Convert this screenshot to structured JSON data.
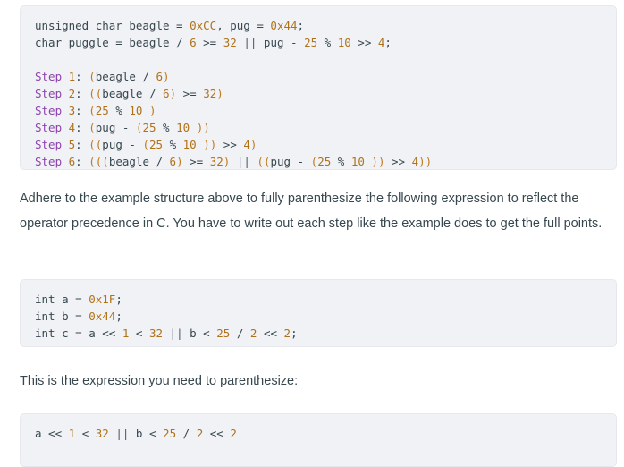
{
  "example_block": {
    "name": "example-code-block",
    "lines": [
      [
        {
          "t": "unsigned char beagle = ",
          "c": "plain"
        },
        {
          "t": "0xCC",
          "c": "hex"
        },
        {
          "t": ", pug = ",
          "c": "plain"
        },
        {
          "t": "0x44",
          "c": "hex"
        },
        {
          "t": ";",
          "c": "punct"
        }
      ],
      [
        {
          "t": "char puggle = beagle / ",
          "c": "plain"
        },
        {
          "t": "6",
          "c": "num"
        },
        {
          "t": " >= ",
          "c": "plain"
        },
        {
          "t": "32",
          "c": "num"
        },
        {
          "t": " ",
          "c": "plain"
        },
        {
          "t": "||",
          "c": "or"
        },
        {
          "t": " pug - ",
          "c": "plain"
        },
        {
          "t": "25",
          "c": "num"
        },
        {
          "t": " % ",
          "c": "plain"
        },
        {
          "t": "10",
          "c": "num"
        },
        {
          "t": " >> ",
          "c": "plain"
        },
        {
          "t": "4",
          "c": "num"
        },
        {
          "t": ";",
          "c": "punct"
        }
      ],
      [
        {
          "t": "",
          "c": "plain"
        }
      ],
      [
        {
          "t": "Step",
          "c": "step"
        },
        {
          "t": " ",
          "c": "plain"
        },
        {
          "t": "1",
          "c": "num"
        },
        {
          "t": ": ",
          "c": "plain"
        },
        {
          "t": "(",
          "c": "paren"
        },
        {
          "t": "beagle / ",
          "c": "plain"
        },
        {
          "t": "6",
          "c": "num"
        },
        {
          "t": ")",
          "c": "paren"
        }
      ],
      [
        {
          "t": "Step",
          "c": "step"
        },
        {
          "t": " ",
          "c": "plain"
        },
        {
          "t": "2",
          "c": "num"
        },
        {
          "t": ": ",
          "c": "plain"
        },
        {
          "t": "((",
          "c": "paren"
        },
        {
          "t": "beagle / ",
          "c": "plain"
        },
        {
          "t": "6",
          "c": "num"
        },
        {
          "t": ")",
          "c": "paren"
        },
        {
          "t": " >= ",
          "c": "plain"
        },
        {
          "t": "32",
          "c": "num"
        },
        {
          "t": ")",
          "c": "paren"
        }
      ],
      [
        {
          "t": "Step",
          "c": "step"
        },
        {
          "t": " ",
          "c": "plain"
        },
        {
          "t": "3",
          "c": "num"
        },
        {
          "t": ": ",
          "c": "plain"
        },
        {
          "t": "(",
          "c": "paren"
        },
        {
          "t": "25",
          "c": "num"
        },
        {
          "t": " % ",
          "c": "plain"
        },
        {
          "t": "10",
          "c": "num"
        },
        {
          "t": " ",
          "c": "plain"
        },
        {
          "t": ")",
          "c": "paren"
        }
      ],
      [
        {
          "t": "Step",
          "c": "step"
        },
        {
          "t": " ",
          "c": "plain"
        },
        {
          "t": "4",
          "c": "num"
        },
        {
          "t": ": ",
          "c": "plain"
        },
        {
          "t": "(",
          "c": "paren"
        },
        {
          "t": "pug - ",
          "c": "plain"
        },
        {
          "t": "(",
          "c": "paren"
        },
        {
          "t": "25",
          "c": "num"
        },
        {
          "t": " % ",
          "c": "plain"
        },
        {
          "t": "10",
          "c": "num"
        },
        {
          "t": " ",
          "c": "plain"
        },
        {
          "t": "))",
          "c": "paren"
        }
      ],
      [
        {
          "t": "Step",
          "c": "step"
        },
        {
          "t": " ",
          "c": "plain"
        },
        {
          "t": "5",
          "c": "num"
        },
        {
          "t": ": ",
          "c": "plain"
        },
        {
          "t": "((",
          "c": "paren"
        },
        {
          "t": "pug - ",
          "c": "plain"
        },
        {
          "t": "(",
          "c": "paren"
        },
        {
          "t": "25",
          "c": "num"
        },
        {
          "t": " % ",
          "c": "plain"
        },
        {
          "t": "10",
          "c": "num"
        },
        {
          "t": " ",
          "c": "plain"
        },
        {
          "t": "))",
          "c": "paren"
        },
        {
          "t": " >> ",
          "c": "plain"
        },
        {
          "t": "4",
          "c": "num"
        },
        {
          "t": ")",
          "c": "paren"
        }
      ],
      [
        {
          "t": "Step",
          "c": "step"
        },
        {
          "t": " ",
          "c": "plain"
        },
        {
          "t": "6",
          "c": "num"
        },
        {
          "t": ": ",
          "c": "plain"
        },
        {
          "t": "(((",
          "c": "paren"
        },
        {
          "t": "beagle / ",
          "c": "plain"
        },
        {
          "t": "6",
          "c": "num"
        },
        {
          "t": ")",
          "c": "paren"
        },
        {
          "t": " >= ",
          "c": "plain"
        },
        {
          "t": "32",
          "c": "num"
        },
        {
          "t": ")",
          "c": "paren"
        },
        {
          "t": " ",
          "c": "plain"
        },
        {
          "t": "||",
          "c": "or"
        },
        {
          "t": " ",
          "c": "plain"
        },
        {
          "t": "((",
          "c": "paren"
        },
        {
          "t": "pug - ",
          "c": "plain"
        },
        {
          "t": "(",
          "c": "paren"
        },
        {
          "t": "25",
          "c": "num"
        },
        {
          "t": " % ",
          "c": "plain"
        },
        {
          "t": "10",
          "c": "num"
        },
        {
          "t": " ",
          "c": "plain"
        },
        {
          "t": "))",
          "c": "paren"
        },
        {
          "t": " >> ",
          "c": "plain"
        },
        {
          "t": "4",
          "c": "num"
        },
        {
          "t": "))",
          "c": "paren"
        }
      ]
    ],
    "plain_text": "unsigned char beagle = 0xCC, pug = 0x44;\nchar puggle = beagle / 6 >= 32 || pug - 25 % 10 >> 4;\n\nStep 1: (beagle / 6)\nStep 2: ((beagle / 6) >= 32)\nStep 3: (25 % 10 )\nStep 4: (pug - (25 % 10 ))\nStep 5: ((pug - (25 % 10 )) >> 4)\nStep 6: (((beagle / 6) >= 32) || ((pug - (25 % 10 )) >> 4))"
  },
  "instructions": {
    "name": "instructions-paragraph",
    "text": "Adhere to the example structure above to fully parenthesize the following expression to reflect the operator precedence in C. You have to write out each step like the example does to get the full points."
  },
  "problem_block": {
    "name": "problem-code-block",
    "lines": [
      [
        {
          "t": "int a = ",
          "c": "plain"
        },
        {
          "t": "0x1F",
          "c": "hex"
        },
        {
          "t": ";",
          "c": "punct"
        }
      ],
      [
        {
          "t": "int b = ",
          "c": "plain"
        },
        {
          "t": "0x44",
          "c": "hex"
        },
        {
          "t": ";",
          "c": "punct"
        }
      ],
      [
        {
          "t": "int c = a << ",
          "c": "plain"
        },
        {
          "t": "1",
          "c": "num"
        },
        {
          "t": " < ",
          "c": "plain"
        },
        {
          "t": "32",
          "c": "num"
        },
        {
          "t": " ",
          "c": "plain"
        },
        {
          "t": "||",
          "c": "or"
        },
        {
          "t": " b < ",
          "c": "plain"
        },
        {
          "t": "25",
          "c": "num"
        },
        {
          "t": " / ",
          "c": "plain"
        },
        {
          "t": "2",
          "c": "num"
        },
        {
          "t": " << ",
          "c": "plain"
        },
        {
          "t": "2",
          "c": "num"
        },
        {
          "t": ";",
          "c": "punct"
        }
      ]
    ],
    "plain_text": "int a = 0x1F;\nint b = 0x44;\nint c = a << 1 < 32 || b < 25 / 2 << 2;"
  },
  "expression_prompt": {
    "name": "expression-prompt-paragraph",
    "text": "This is the expression you need to parenthesize:"
  },
  "expression_block": {
    "name": "expression-code-block",
    "lines": [
      [
        {
          "t": "a << ",
          "c": "plain"
        },
        {
          "t": "1",
          "c": "num"
        },
        {
          "t": " < ",
          "c": "plain"
        },
        {
          "t": "32",
          "c": "num"
        },
        {
          "t": " ",
          "c": "plain"
        },
        {
          "t": "||",
          "c": "or"
        },
        {
          "t": " b < ",
          "c": "plain"
        },
        {
          "t": "25",
          "c": "num"
        },
        {
          "t": " / ",
          "c": "plain"
        },
        {
          "t": "2",
          "c": "num"
        },
        {
          "t": " << ",
          "c": "plain"
        },
        {
          "t": "2",
          "c": "num"
        }
      ]
    ],
    "plain_text": "a << 1 < 32 || b < 25 / 2 << 2"
  },
  "colors": {
    "page_background": "#ffffff",
    "code_background": "#f1f2f6",
    "code_border": "#e6e8ed",
    "text": "#37474f",
    "number": "#b07219",
    "paren": "#c07b20",
    "step_keyword": "#8e44ad"
  }
}
